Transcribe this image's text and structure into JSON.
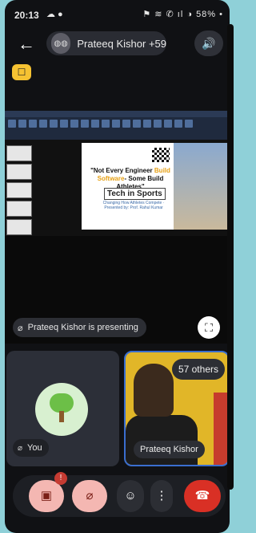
{
  "status_bar": {
    "time": "20:13",
    "left_icons": "☁ ●",
    "right_icons": "⚑ ≋ ✆ ıl ◑ 58% •"
  },
  "topbar": {
    "back_icon": "←",
    "meeting_title": "Prateeq Kishor +59",
    "avatars_label": "◍◍",
    "speaker_icon": "🔊"
  },
  "hand_badge": "☐",
  "presentation": {
    "slide_quote_1": "\"Not Every Engineer ",
    "slide_quote_hl1": "Build",
    "slide_quote_2": " ",
    "slide_quote_hl2": "Software",
    "slide_quote_3": "- Some Build Athletes\"",
    "slide_title": "Tech in Sports",
    "slide_sub": "Changing How Athletes Compete · Presented by: Prof. Rahul Kumar"
  },
  "presenting_chip": {
    "mic_icon": "⌀",
    "text": "Prateeq Kishor is presenting"
  },
  "fullscreen_icon": "⛶",
  "tile_you": {
    "mic_icon": "⌀",
    "name": "You"
  },
  "tile_other": {
    "others_label": "57 others",
    "name": "Prateeq Kishor"
  },
  "controls": {
    "camera_icon": "▣",
    "camera_alert": "!",
    "mic_icon": "⌀",
    "react_icon": "☺",
    "more_icon": "⋮",
    "end_icon": "☎"
  },
  "colors": {
    "end_call": "#d93025",
    "muted_button": "#f4b7b2",
    "active_tile_border": "#3a6ecf",
    "hand_badge": "#f5c232"
  }
}
